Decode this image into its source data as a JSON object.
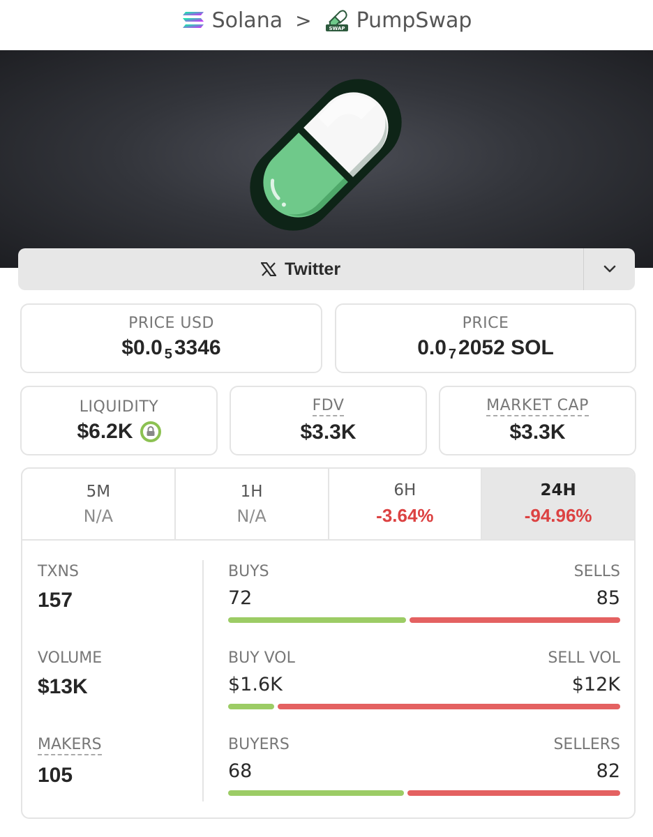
{
  "breadcrumb": {
    "chain": "Solana",
    "separator": ">",
    "dex": "PumpSwap",
    "dex_badge": "SWAP"
  },
  "social": {
    "twitter_label": "Twitter"
  },
  "cards": {
    "price_usd": {
      "label": "PRICE USD",
      "prefix": "$0.0",
      "zeros": "5",
      "digits": "3346"
    },
    "price_sol": {
      "label": "PRICE",
      "prefix": "0.0",
      "zeros": "7",
      "digits": "2052 SOL"
    },
    "liquidity": {
      "label": "LIQUIDITY",
      "value": "$6.2K"
    },
    "fdv": {
      "label": "FDV",
      "value": "$3.3K"
    },
    "market_cap": {
      "label": "MARKET CAP",
      "value": "$3.3K"
    }
  },
  "timeframes": [
    {
      "label": "5M",
      "value": "N/A"
    },
    {
      "label": "1H",
      "value": "N/A"
    },
    {
      "label": "6H",
      "value": "-3.64%"
    },
    {
      "label": "24H",
      "value": "-94.96%"
    }
  ],
  "metrics": {
    "txns": {
      "label": "TXNS",
      "value": "157"
    },
    "volume": {
      "label": "VOLUME",
      "value": "$13K"
    },
    "makers": {
      "label": "MAKERS",
      "value": "105"
    },
    "buys_sells": {
      "left_label": "BUYS",
      "right_label": "SELLS",
      "left_value": "72",
      "right_value": "85",
      "buy_fraction": 0.4586
    },
    "vol_split": {
      "left_label": "BUY VOL",
      "right_label": "SELL VOL",
      "left_value": "$1.6K",
      "right_value": "$12K",
      "buy_fraction": 0.1176
    },
    "buyers_sellers": {
      "left_label": "BUYERS",
      "right_label": "SELLERS",
      "left_value": "68",
      "right_value": "82",
      "buy_fraction": 0.4533
    }
  },
  "colors": {
    "buy": "#9ccc65",
    "sell": "#e46161",
    "negative": "#dc4242",
    "pill_green": "#6fc98a"
  }
}
